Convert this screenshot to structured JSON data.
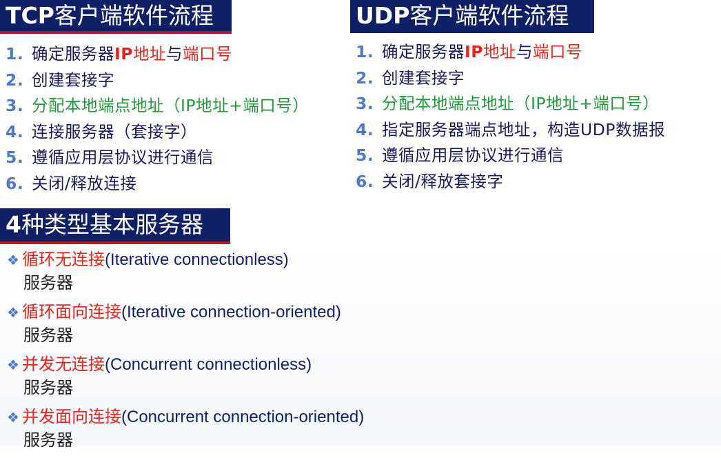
{
  "tcp": {
    "title_bold": "TCP",
    "title_rest": "客户端软件流程",
    "steps": [
      {
        "num": "1.",
        "a": "确定服务器",
        "b": "IP",
        "c": "地址",
        "d": "与",
        "e": "端口号"
      },
      {
        "num": "2.",
        "text": "创建套接字"
      },
      {
        "num": "3.",
        "text": "分配本地端点地址（IP地址+端口号）"
      },
      {
        "num": "4.",
        "text": "连接服务器（套接字）"
      },
      {
        "num": "5.",
        "text": "遵循应用层协议进行通信"
      },
      {
        "num": "6.",
        "text": "关闭/释放连接"
      }
    ]
  },
  "udp": {
    "title_bold": "UDP",
    "title_rest": "客户端软件流程",
    "steps": [
      {
        "num": "1.",
        "a": "确定服务器",
        "b": "IP",
        "c": "地址",
        "d": "与",
        "e": "端口号"
      },
      {
        "num": "2.",
        "text": "创建套接字"
      },
      {
        "num": "3.",
        "text": "分配本地端点地址（IP地址+端口号）"
      },
      {
        "num": "4.",
        "text": "指定服务器端点地址，构造UDP数据报"
      },
      {
        "num": "5.",
        "text": "遵循应用层协议进行通信"
      },
      {
        "num": "6.",
        "text": "关闭/释放套接字"
      }
    ]
  },
  "servers": {
    "title_bold": "4",
    "title_rest": "种类型基本服务器",
    "bullet": "❖",
    "items": [
      {
        "zh": "循环无连接",
        "en": "(Iterative connectionless)",
        "suffix": "服务器"
      },
      {
        "zh": "循环面向连接",
        "en": "(Iterative connection-oriented)",
        "suffix": "服务器"
      },
      {
        "zh": "并发无连接",
        "en": "(Concurrent connectionless)",
        "suffix": "服务器"
      },
      {
        "zh": "并发面向连接",
        "en": "(Concurrent connection-oriented)",
        "suffix": "服务器"
      }
    ]
  },
  "colors": {
    "title_bg": "#0e2167",
    "accent_red": "#e8231b",
    "accent_green": "#1f9b3a",
    "number_blue": "#4f78c7"
  }
}
